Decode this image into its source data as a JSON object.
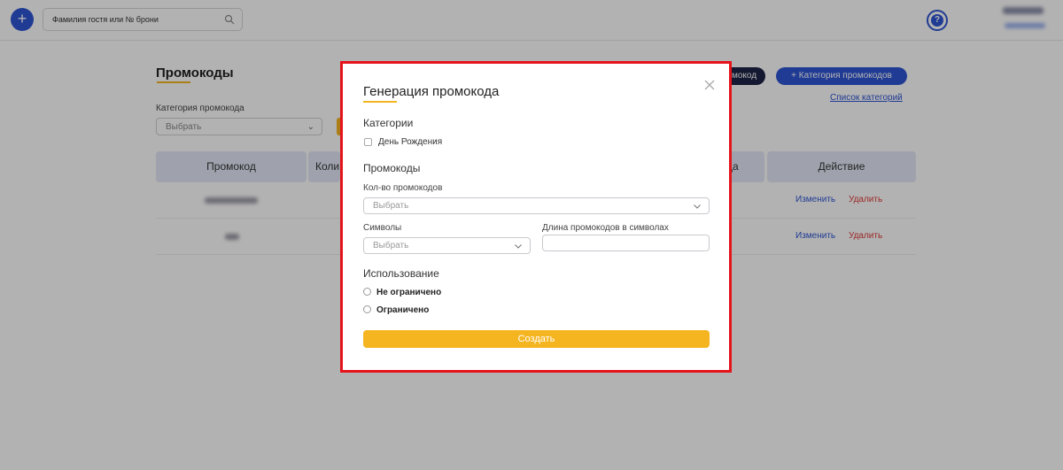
{
  "topbar": {
    "add_icon": "plus-icon",
    "search_placeholder": "Фамилия гостя или № брони",
    "search_icon": "search-icon",
    "help_icon": "?"
  },
  "page": {
    "title": "Промокоды",
    "category_label": "Категория промокода",
    "category_select_value": "Выбрать",
    "dark_button_label": "мокод",
    "add_category_button": "+ Категория промокодов",
    "category_list_link": "Список категорий"
  },
  "table": {
    "headers": {
      "promo": "Промокод",
      "qty": "Коли",
      "mid": "да",
      "action": "Действие"
    },
    "rows": [
      {
        "edit": "Изменить",
        "delete": "Удалить"
      },
      {
        "edit": "Изменить",
        "delete": "Удалить"
      }
    ]
  },
  "modal": {
    "title": "Генерация промокода",
    "categories_heading": "Категории",
    "category_option": "День Рождения",
    "promocodes_heading": "Промокоды",
    "count_label": "Кол-во промокодов",
    "count_value": "Выбрать",
    "symbols_label": "Символы",
    "symbols_value": "Выбрать",
    "length_label": "Длина промокодов в символах",
    "length_value": "",
    "usage_heading": "Использование",
    "usage_options": [
      "Не ограничено",
      "Ограничено"
    ],
    "create_button": "Создать"
  },
  "colors": {
    "accent_blue": "#2f55d4",
    "accent_yellow": "#f5b521",
    "danger_red": "#e03b3b",
    "highlight_frame": "#e5141b"
  }
}
